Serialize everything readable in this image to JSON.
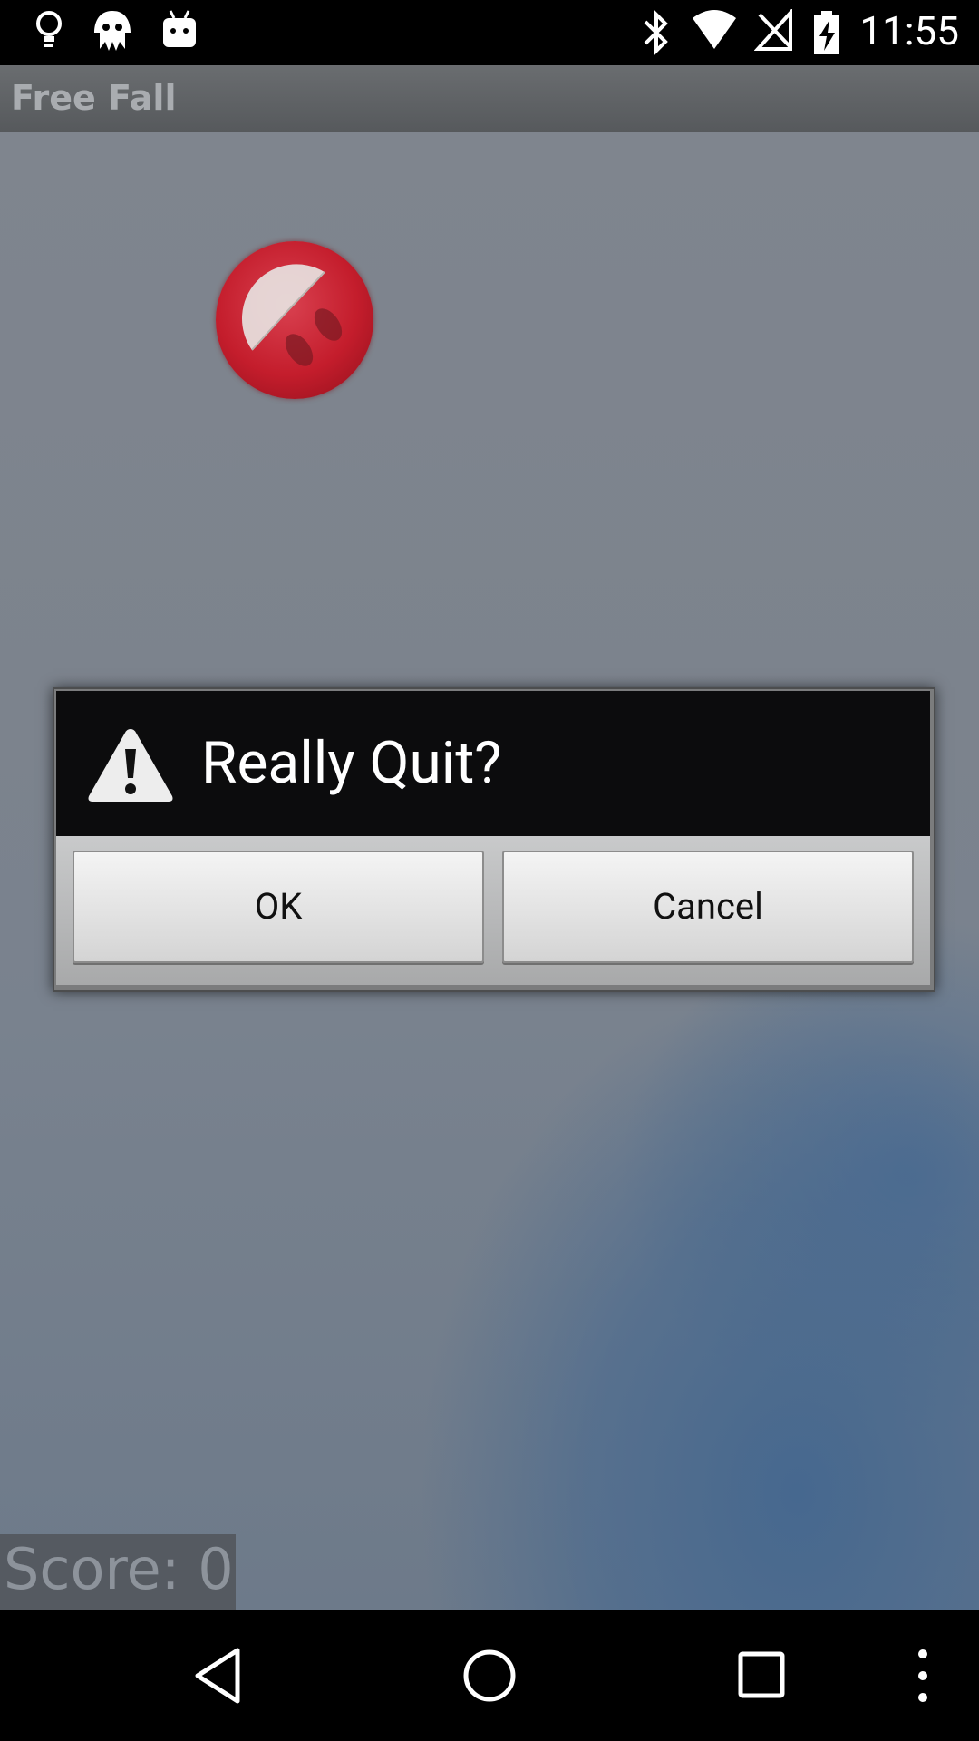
{
  "status_bar": {
    "time": "11:55",
    "icons": [
      "lightbulb-icon",
      "alien-icon",
      "android-icon",
      "bluetooth-icon",
      "wifi-icon",
      "no-signal-icon",
      "battery-charging-icon"
    ]
  },
  "app": {
    "title": "Free Fall"
  },
  "game": {
    "score_text": "Score: 0"
  },
  "dialog": {
    "title": "Really Quit?",
    "icon": "warning-icon",
    "ok_label": "OK",
    "cancel_label": "Cancel"
  },
  "nav_bar": {
    "icons": [
      "back-icon",
      "home-icon",
      "recents-icon",
      "menu-icon"
    ]
  }
}
